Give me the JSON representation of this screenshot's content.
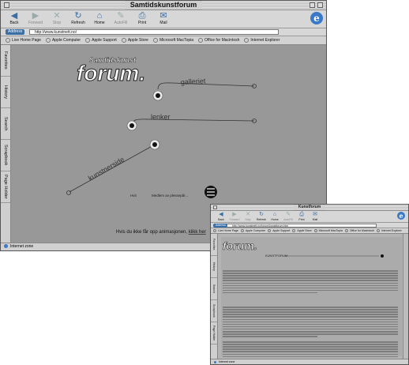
{
  "window1": {
    "title": "Samtidskunstforum",
    "toolbar": [
      {
        "label": "Back",
        "icon": "back-arrow-icon",
        "glyph": "◀",
        "disabled": false
      },
      {
        "label": "Forward",
        "icon": "forward-arrow-icon",
        "glyph": "▶",
        "disabled": true
      },
      {
        "label": "Stop",
        "icon": "stop-icon",
        "glyph": "✕",
        "disabled": true
      },
      {
        "label": "Refresh",
        "icon": "refresh-icon",
        "glyph": "↻",
        "disabled": false
      },
      {
        "label": "Home",
        "icon": "home-icon",
        "glyph": "⌂",
        "disabled": false
      },
      {
        "label": "AutoFill",
        "icon": "autofill-icon",
        "glyph": "✎",
        "disabled": true
      },
      {
        "label": "Print",
        "icon": "print-icon",
        "glyph": "⎙",
        "disabled": false
      },
      {
        "label": "Mail",
        "icon": "mail-icon",
        "glyph": "✉",
        "disabled": false
      }
    ],
    "address_label": "Address",
    "address_value": "http://www.kunstnett.no/",
    "favorites": [
      "Live Home Page",
      "Apple Computer",
      "Apple Support",
      "Apple Store",
      "Microsoft MacTopia",
      "Office for Macintosh",
      "Internet Explorer"
    ],
    "side_tabs": [
      "Favorites",
      "History",
      "Search",
      "Scrapbook",
      "Page Holder"
    ],
    "logo_top": "Samtidskunst",
    "logo_main": "forum.",
    "nav_links": [
      "galleriet",
      "lenker",
      "kunstnerside"
    ],
    "small_labels": [
      "Hvit",
      "Medlem av plessepår..."
    ],
    "footer_text": "Hvis du ikke får opp animasjonen, ",
    "footer_link": "klikk her",
    "status": "Internet zone"
  },
  "window2": {
    "title": "Kunstforum",
    "toolbar": [
      {
        "label": "Back",
        "glyph": "◀",
        "disabled": false
      },
      {
        "label": "Forward",
        "glyph": "▶",
        "disabled": true
      },
      {
        "label": "Stop",
        "glyph": "✕",
        "disabled": true
      },
      {
        "label": "Refresh",
        "glyph": "↻",
        "disabled": false
      },
      {
        "label": "Home",
        "glyph": "⌂",
        "disabled": false
      },
      {
        "label": "AutoFill",
        "glyph": "✎",
        "disabled": true
      },
      {
        "label": "Print",
        "glyph": "⎙",
        "disabled": false
      },
      {
        "label": "Mail",
        "glyph": "✉",
        "disabled": false
      }
    ],
    "address_label": "Address",
    "address_value": "http://www.kunstnett.no/forum/kunstforum.htm",
    "favorites": [
      "Live Home Page",
      "Apple Computer",
      "Apple Support",
      "Apple Store",
      "Microsoft MacTopia",
      "Office for Macintosh",
      "Internet Explorer"
    ],
    "side_tabs": [
      "Favorites",
      "History",
      "Search",
      "Scrapbook",
      "Page Holder"
    ],
    "logo": "forum.",
    "heading": "KUNSTFORUM",
    "status": "Internet zone"
  },
  "colors": {
    "content_bg": "#989898",
    "chrome": "#c6c6c6",
    "accent": "#3a6ea5"
  }
}
